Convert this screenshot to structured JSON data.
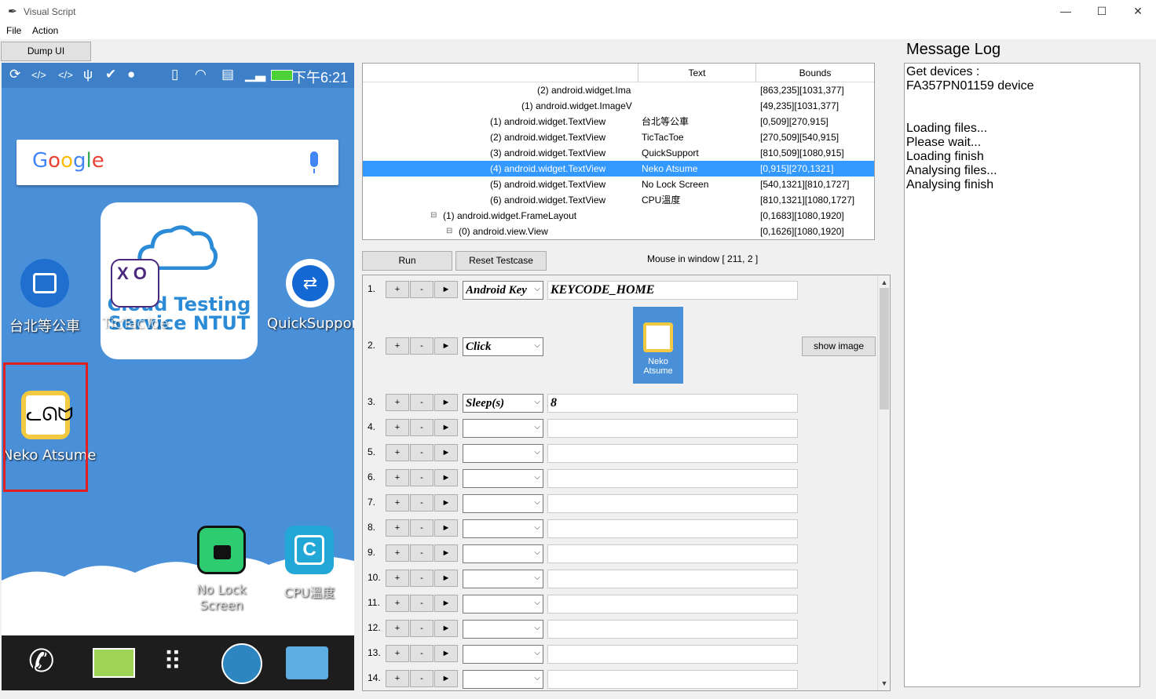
{
  "window": {
    "title": "Visual Script"
  },
  "menu": {
    "file": "File",
    "action": "Action"
  },
  "toolbar": {
    "dump_ui": "Dump UI"
  },
  "phone": {
    "status_time": "下午6:21",
    "search_logo": "Google",
    "cloud_text_line1": "Cloud Testing",
    "cloud_text_line2": "Service NTUT",
    "apps": {
      "bus": "台北等公車",
      "tictactoe": "TicTacToe",
      "quicksupport": "QuickSupport",
      "neko": "Neko Atsume",
      "nolock1": "No Lock",
      "nolock2": "Screen",
      "cpu": "CPU溫度"
    }
  },
  "tree": {
    "headers": {
      "text": "Text",
      "bounds": "Bounds"
    },
    "rows": [
      {
        "node": "(2) android.widget.Ima",
        "text": "",
        "bounds": "[863,235][1031,377]"
      },
      {
        "node": "(1) android.widget.ImageV",
        "text": "",
        "bounds": "[49,235][1031,377]"
      },
      {
        "node": "(1) android.widget.TextView",
        "text": "台北等公車",
        "bounds": "[0,509][270,915]"
      },
      {
        "node": "(2) android.widget.TextView",
        "text": "TicTacToe",
        "bounds": "[270,509][540,915]"
      },
      {
        "node": "(3) android.widget.TextView",
        "text": "QuickSupport",
        "bounds": "[810,509][1080,915]"
      },
      {
        "node": "(4) android.widget.TextView",
        "text": "Neko Atsume",
        "bounds": "[0,915][270,1321]"
      },
      {
        "node": "(5) android.widget.TextView",
        "text": "No Lock Screen",
        "bounds": "[540,1321][810,1727]"
      },
      {
        "node": "(6) android.widget.TextView",
        "text": "CPU溫度",
        "bounds": "[810,1321][1080,1727]"
      },
      {
        "node": "(1) android.widget.FrameLayout",
        "text": "",
        "bounds": "[0,1683][1080,1920]"
      },
      {
        "node": "(0) android.view.View",
        "text": "",
        "bounds": "[0,1626][1080,1920]"
      }
    ]
  },
  "controls": {
    "run": "Run",
    "reset": "Reset Testcase",
    "mouse": "Mouse in window [ 211, 2 ]"
  },
  "script": {
    "plus": "+",
    "minus": "-",
    "play": "►",
    "show_image": "show image",
    "thumb_label": "Neko Atsume",
    "rows": [
      {
        "num": "1.",
        "action": "Android Key",
        "value": "KEYCODE_HOME"
      },
      {
        "num": "2.",
        "action": "Click",
        "value": ""
      },
      {
        "num": "3.",
        "action": "Sleep(s)",
        "value": "8"
      },
      {
        "num": "4.",
        "action": "",
        "value": ""
      },
      {
        "num": "5.",
        "action": "",
        "value": ""
      },
      {
        "num": "6.",
        "action": "",
        "value": ""
      },
      {
        "num": "7.",
        "action": "",
        "value": ""
      },
      {
        "num": "8.",
        "action": "",
        "value": ""
      },
      {
        "num": "9.",
        "action": "",
        "value": ""
      },
      {
        "num": "10.",
        "action": "",
        "value": ""
      },
      {
        "num": "11.",
        "action": "",
        "value": ""
      },
      {
        "num": "12.",
        "action": "",
        "value": ""
      },
      {
        "num": "13.",
        "action": "",
        "value": ""
      },
      {
        "num": "14.",
        "action": "",
        "value": ""
      }
    ]
  },
  "log": {
    "title": "Message Log",
    "lines": [
      "Get devices :",
      "FA357PN01159 device",
      "",
      "",
      "Loading files...",
      "Please wait...",
      "Loading finish",
      "Analysing files...",
      "Analysing finish"
    ]
  },
  "colors": {
    "selection": "#3399ff",
    "phone_bg": "#4a90d9",
    "highlight": "#e02020"
  },
  "icons": [
    "feather-icon",
    "sync-icon",
    "usb-icon",
    "android-icon",
    "vibrate-icon",
    "wifi-icon",
    "battery-icon",
    "mic-icon",
    "phone-icon",
    "messages-icon",
    "apps-grid-icon",
    "globe-icon",
    "camera-icon"
  ]
}
